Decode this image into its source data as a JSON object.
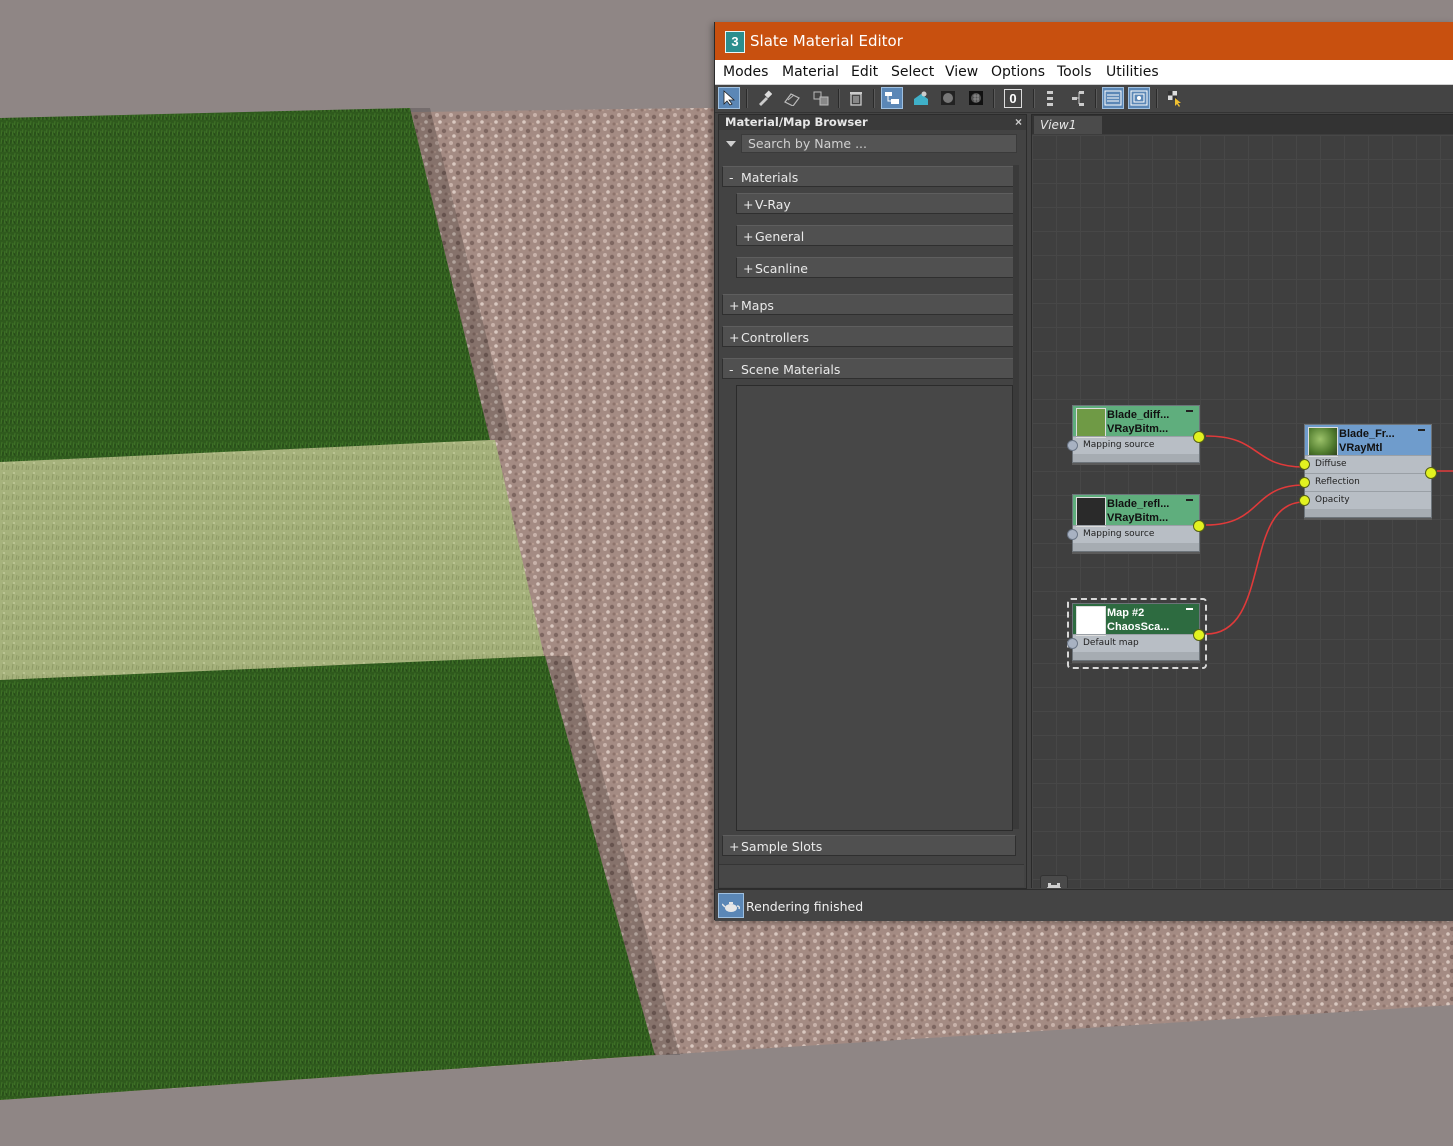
{
  "window": {
    "title": "Slate Material Editor",
    "logo_glyph": "3"
  },
  "menu": [
    "Modes",
    "Material",
    "Edit",
    "Select",
    "View",
    "Options",
    "Tools",
    "Utilities"
  ],
  "toolbar": {
    "numeric_field": "0"
  },
  "browser": {
    "title": "Material/Map Browser",
    "close": "×",
    "search_placeholder": "Search by Name ...",
    "sections": [
      {
        "sign": "-",
        "label": "Materials"
      },
      {
        "sign": "+",
        "label": "V-Ray"
      },
      {
        "sign": "+",
        "label": "General"
      },
      {
        "sign": "+",
        "label": "Scanline"
      },
      {
        "sign": "+",
        "label": "Maps"
      },
      {
        "sign": "+",
        "label": "Controllers"
      },
      {
        "sign": "-",
        "label": "Scene Materials"
      },
      {
        "sign": "+",
        "label": "Sample Slots"
      }
    ]
  },
  "view": {
    "tab": "View1"
  },
  "nodes": {
    "diffuse_map": {
      "name": "Blade_diff...",
      "type": "VRayBitm...",
      "slot": "Mapping source"
    },
    "refl_map": {
      "name": "Blade_refl...",
      "type": "VRayBitm...",
      "slot": "Mapping source"
    },
    "scatter_map": {
      "name": "Map #2",
      "type": "ChaosSca...",
      "slot": "Default map"
    },
    "material": {
      "name": "Blade_Fr...",
      "type": "VRayMtl",
      "slots": [
        "Diffuse",
        "Reflection",
        "Opacity"
      ]
    }
  },
  "colors": {
    "title_bar": "#c8500f",
    "wire": "#e03a3a",
    "port": "#e2f21f",
    "accent": "#5b87b6"
  },
  "status": {
    "text": "Rendering finished"
  }
}
